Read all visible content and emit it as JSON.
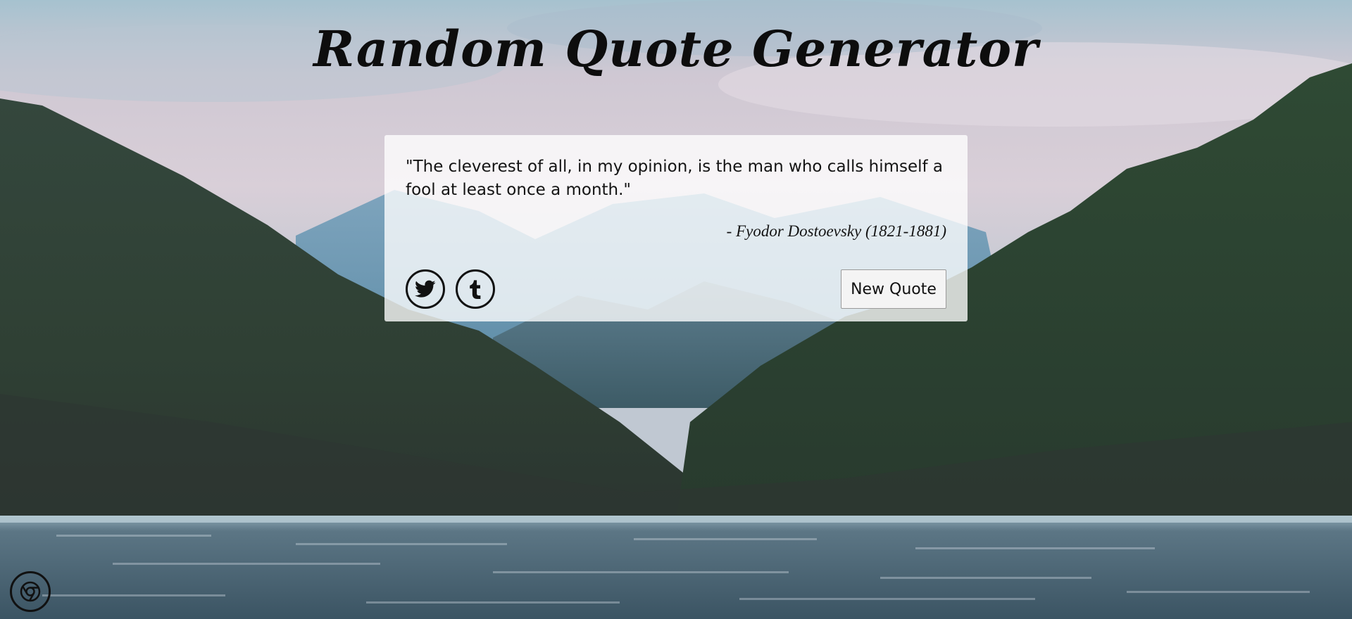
{
  "app": {
    "title": "Random Quote Generator"
  },
  "quote": {
    "text": "\"The cleverest of all, in my opinion, is the man who calls himself a fool at least once a month.\"",
    "author": "- Fyodor Dostoevsky (1821-1881)"
  },
  "actions": {
    "twitter_icon": "twitter-icon",
    "tumblr_icon": "tumblr-icon",
    "new_quote_label": "New Quote"
  },
  "badge": {
    "icon": "chrome-icon"
  },
  "colors": {
    "title": "#0d0d0d",
    "card_background": "rgba(255,255,255,0.78)",
    "text": "#141414"
  }
}
